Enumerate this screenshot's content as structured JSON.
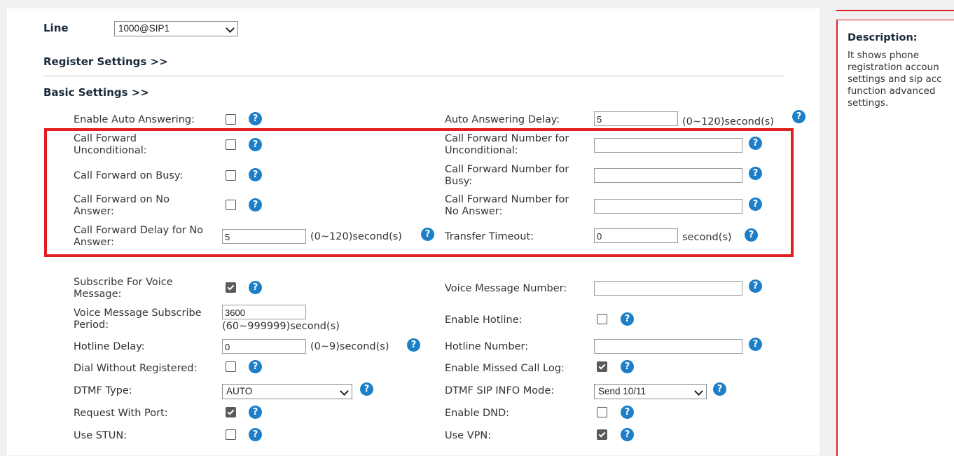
{
  "line": {
    "label": "Line",
    "value": "1000@SIP1"
  },
  "sections": {
    "register": "Register Settings >>",
    "basic": "Basic Settings >>"
  },
  "help_glyph": "?",
  "fields": {
    "auto_answer": {
      "label": "Enable Auto Answering:",
      "checked": false
    },
    "auto_answer_delay": {
      "label": "Auto Answering Delay:",
      "value": "5",
      "unit": "(0~120)second(s)"
    },
    "cfu": {
      "label": "Call Forward\nUnconditional:",
      "checked": false
    },
    "cfu_number": {
      "label": "Call Forward Number for\nUnconditional:",
      "value": ""
    },
    "cfb": {
      "label": "Call Forward on Busy:",
      "checked": false
    },
    "cfb_number": {
      "label": "Call Forward Number for\nBusy:",
      "value": ""
    },
    "cfna": {
      "label": "Call Forward on No\nAnswer:",
      "checked": false
    },
    "cfna_number": {
      "label": "Call Forward Number for\nNo Answer:",
      "value": ""
    },
    "cf_delay": {
      "label": "Call Forward Delay for No\nAnswer:",
      "value": "5",
      "unit": "(0~120)second(s)"
    },
    "transfer_timeout": {
      "label": "Transfer Timeout:",
      "value": "0",
      "unit": "second(s)"
    },
    "subscribe_vm": {
      "label": "Subscribe For Voice\nMessage:",
      "checked": true
    },
    "vm_number": {
      "label": "Voice Message Number:",
      "value": ""
    },
    "vm_period": {
      "label": "Voice Message Subscribe\nPeriod:",
      "value": "3600",
      "unit": "(60~999999)second(s)"
    },
    "hotline": {
      "label": "Enable Hotline:",
      "checked": false
    },
    "hotline_delay": {
      "label": "Hotline Delay:",
      "value": "0",
      "unit": "(0~9)second(s)"
    },
    "hotline_number": {
      "label": "Hotline Number:",
      "value": ""
    },
    "dial_unreg": {
      "label": "Dial Without Registered:",
      "checked": false
    },
    "missed_log": {
      "label": "Enable Missed Call Log:",
      "checked": true
    },
    "dtmf_type": {
      "label": "DTMF Type:",
      "value": "AUTO"
    },
    "dtmf_sip_info": {
      "label": "DTMF SIP INFO Mode:",
      "value": "Send 10/11"
    },
    "request_port": {
      "label": "Request With Port:",
      "checked": true
    },
    "dnd": {
      "label": "Enable DND:",
      "checked": false
    },
    "stun": {
      "label": "Use STUN:",
      "checked": false
    },
    "vpn": {
      "label": "Use VPN:",
      "checked": true
    }
  },
  "description": {
    "title": "Description:",
    "text": "It shows phone\nregistration accoun\nsettings and sip acc\nfunction advanced\nsettings."
  },
  "colors": {
    "highlight": "#e02020",
    "help": "#1e7fc9",
    "accent_border": "#d42525"
  }
}
